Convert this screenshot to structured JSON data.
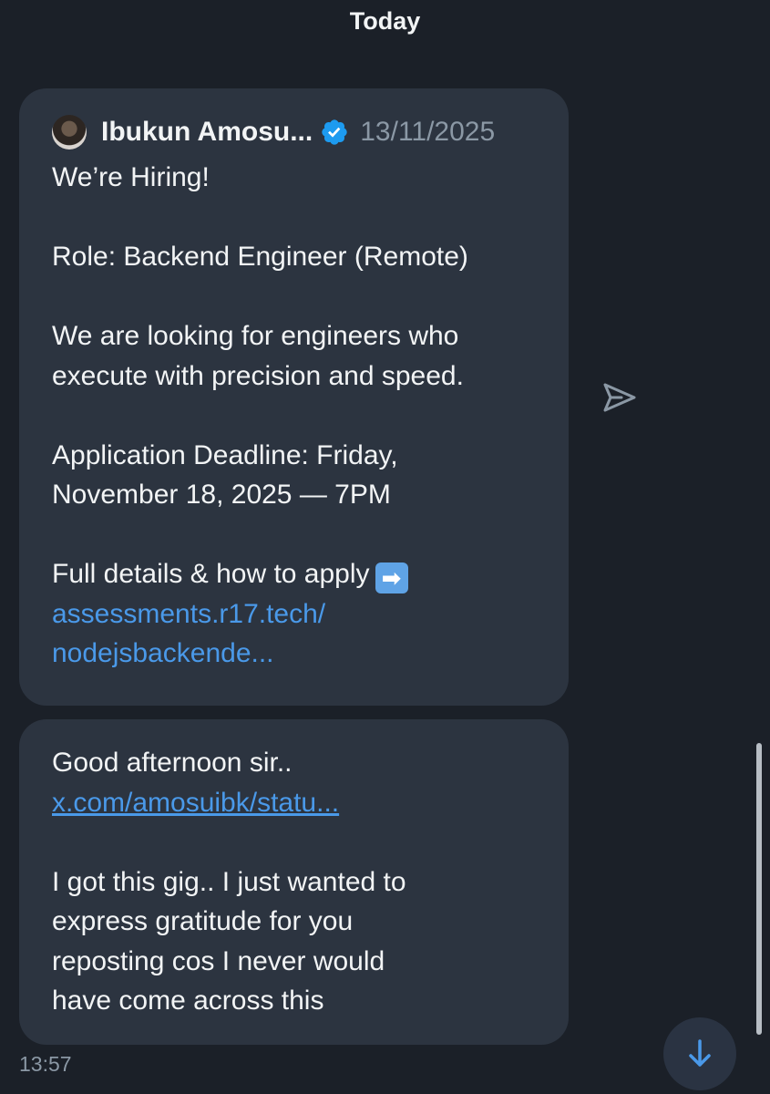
{
  "header": {
    "date": "Today"
  },
  "quoted_post": {
    "author": "Ibukun Amosu...",
    "date": "13/11/2025",
    "lines": [
      "We’re Hiring!",
      "",
      "Role: Backend Engineer (Remote)",
      "",
      "We are looking for engineers who",
      "execute with precision and speed.",
      "",
      "Application Deadline: Friday,",
      "November 18, 2025 — 7PM",
      "",
      "Full details & how to apply"
    ],
    "arrow_emoji": "➡",
    "link_line1": "assessments.r17.tech/",
    "link_line2": "nodejsbackende..."
  },
  "reply": {
    "greeting": "Good afternoon sir..",
    "link": "x.com/amosuibk/statu...",
    "body_lines": [
      "I got this gig.. I just wanted to",
      "express gratitude for you",
      "reposting cos I never would",
      "have come across this"
    ],
    "time": "13:57"
  },
  "icons": {
    "verified": "verified-badge-icon",
    "share": "send-icon",
    "scroll_down": "arrow-down-icon"
  },
  "colors": {
    "background": "#1b2028",
    "bubble": "#2c3440",
    "link": "#4a99e9",
    "verified": "#1d9bf0",
    "muted": "#8b98a5"
  }
}
